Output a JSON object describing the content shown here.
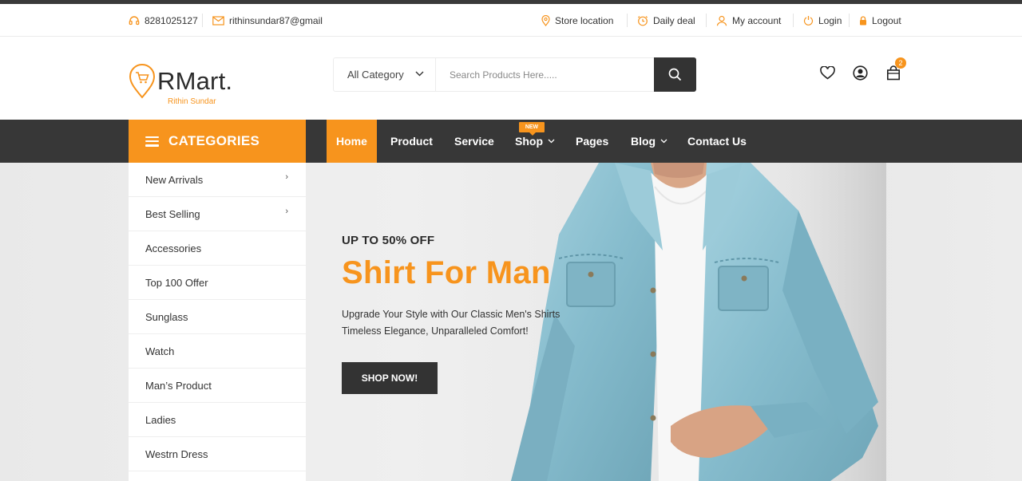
{
  "topbar": {
    "phone": "8281025127",
    "email": "rithinsundar87@gmail",
    "store_location": "Store location",
    "daily_deal": "Daily deal",
    "my_account": "My account",
    "login": "Login",
    "logout": "Logout"
  },
  "header": {
    "logo_text": "RMart.",
    "logo_sub": "Rithin Sundar",
    "category_select": "All Category",
    "search_placeholder": "Search Products Here.....",
    "cart_count": "2"
  },
  "nav": {
    "categories_title": "CATEGORIES",
    "items": [
      {
        "label": "Home"
      },
      {
        "label": "Product"
      },
      {
        "label": "Service"
      },
      {
        "label": "Shop"
      },
      {
        "label": "Pages"
      },
      {
        "label": "Blog"
      },
      {
        "label": "Contact Us"
      }
    ],
    "new_badge": "NEW"
  },
  "sidebar": {
    "items": [
      {
        "label": "New Arrivals"
      },
      {
        "label": "Best Selling"
      },
      {
        "label": "Accessories"
      },
      {
        "label": "Top 100 Offer"
      },
      {
        "label": "Sunglass"
      },
      {
        "label": "Watch"
      },
      {
        "label": "Man’s Product"
      },
      {
        "label": "Ladies"
      },
      {
        "label": "Westrn Dress"
      }
    ]
  },
  "hero": {
    "tag": "UP TO 50% OFF",
    "title": "Shirt For Man",
    "desc_line1": "Upgrade Your Style with Our Classic Men's Shirts",
    "desc_line2": "Timeless Elegance, Unparalleled Comfort!",
    "button": "SHOP NOW!"
  },
  "colors": {
    "accent": "#f7941d",
    "dark": "#373737",
    "denim": "#8ec3d3"
  }
}
